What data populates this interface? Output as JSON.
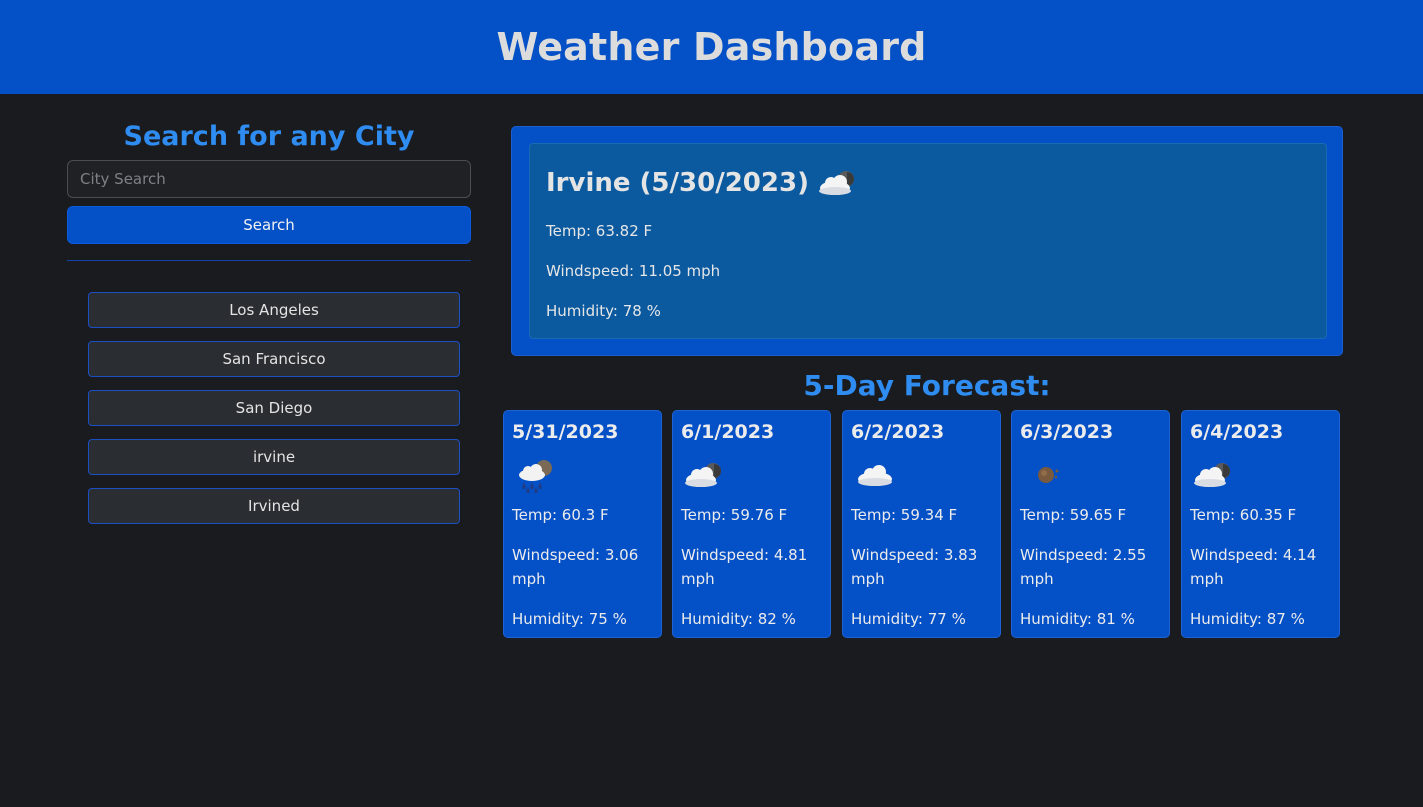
{
  "header": {
    "title": "Weather Dashboard"
  },
  "search": {
    "heading": "Search for any City",
    "placeholder": "City Search",
    "button_label": "Search"
  },
  "history": [
    "Los Angeles",
    "San Francisco",
    "San Diego",
    "irvine",
    "Irvined"
  ],
  "current": {
    "title": "Irvine (5/30/2023)",
    "icon": "cloud-sun-icon",
    "temp": "Temp: 63.82 F",
    "wind": "Windspeed: 11.05 mph",
    "humidity": "Humidity: 78 %"
  },
  "forecast": {
    "heading": "5-Day Forecast:",
    "days": [
      {
        "date": "5/31/2023",
        "icon": "rain-cloud-icon",
        "temp": "Temp: 60.3 F",
        "wind": "Windspeed: 3.06 mph",
        "humidity": "Humidity: 75 %"
      },
      {
        "date": "6/1/2023",
        "icon": "cloud-sun-icon",
        "temp": "Temp: 59.76 F",
        "wind": "Windspeed: 4.81 mph",
        "humidity": "Humidity: 82 %"
      },
      {
        "date": "6/2/2023",
        "icon": "cloud-icon",
        "temp": "Temp: 59.34 F",
        "wind": "Windspeed: 3.83 mph",
        "humidity": "Humidity: 77 %"
      },
      {
        "date": "6/3/2023",
        "icon": "sun-icon",
        "temp": "Temp: 59.65 F",
        "wind": "Windspeed: 2.55 mph",
        "humidity": "Humidity: 81 %"
      },
      {
        "date": "6/4/2023",
        "icon": "cloud-sun-icon",
        "temp": "Temp: 60.35 F",
        "wind": "Windspeed: 4.14 mph",
        "humidity": "Humidity: 87 %"
      }
    ]
  },
  "colors": {
    "brand": "#0450c6",
    "accent_text": "#2f8cf0",
    "background": "#1a1b1e",
    "current_inner": "#0b5aa0"
  }
}
